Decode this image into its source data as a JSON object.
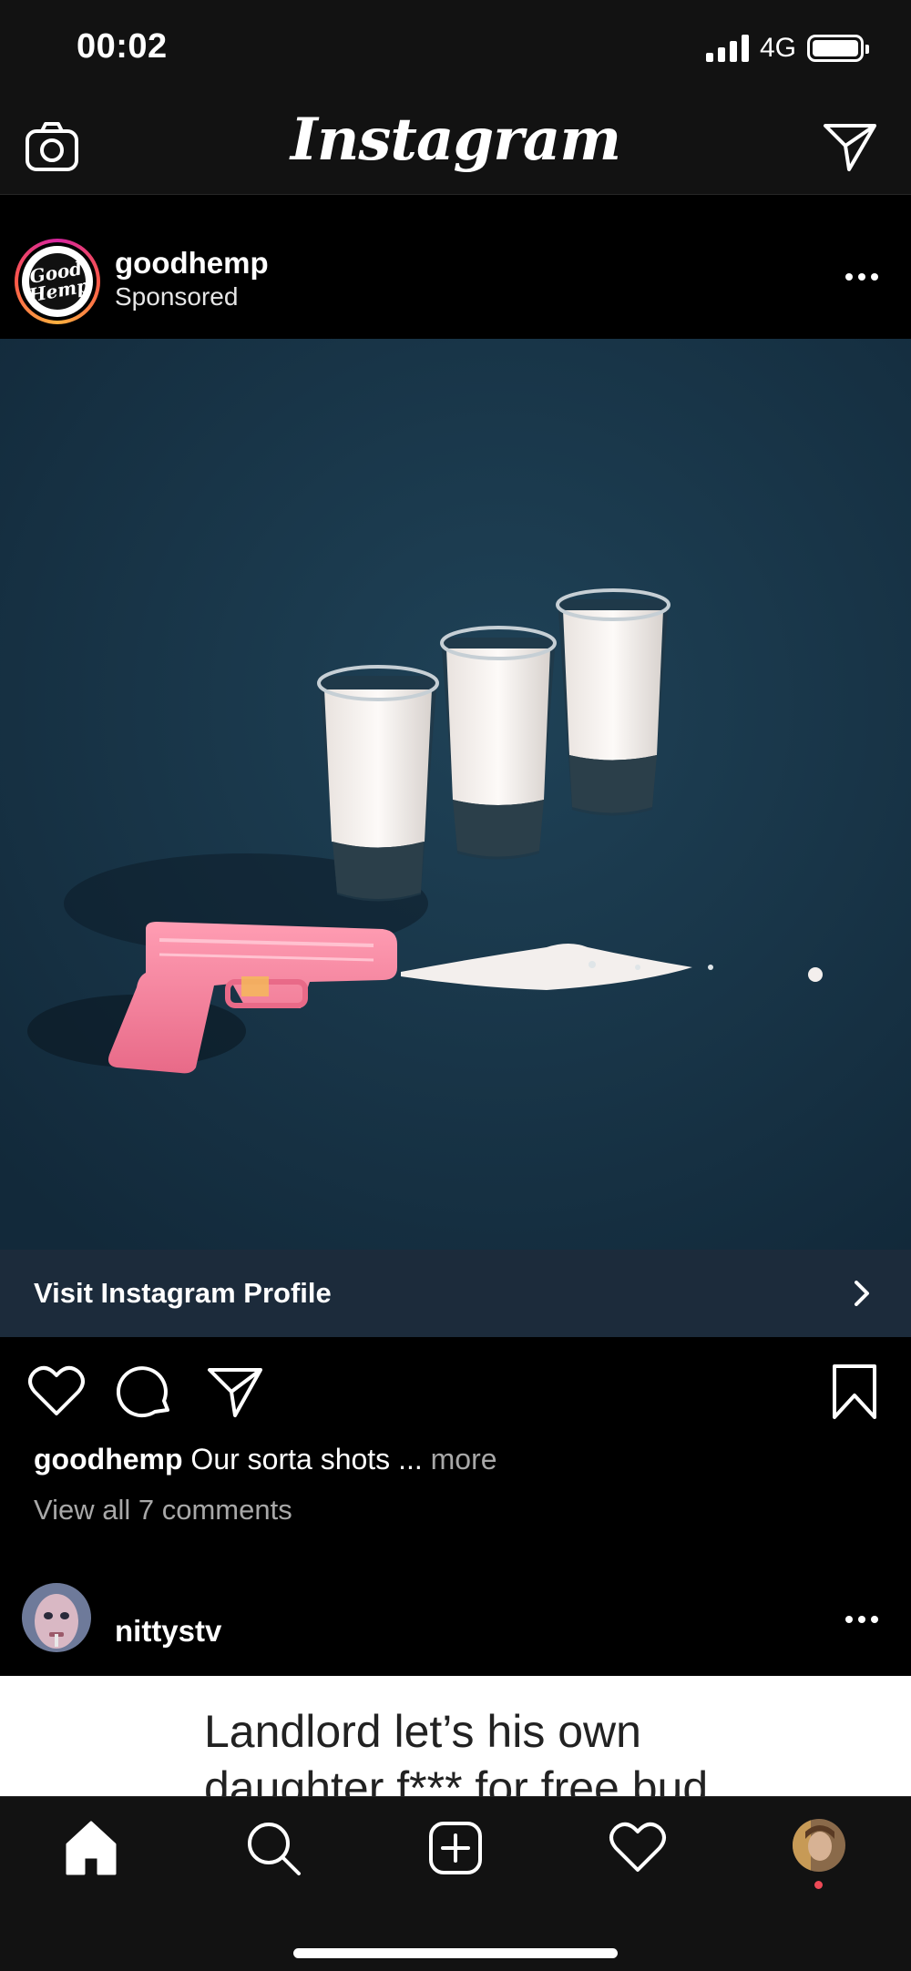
{
  "status_bar": {
    "time": "00:02",
    "network": "4G"
  },
  "header": {
    "logo": "Instagram",
    "icons": {
      "left": "camera-icon",
      "right": "direct-send-icon"
    }
  },
  "post1": {
    "username": "goodhemp",
    "sponsored_label": "Sponsored",
    "avatar_text": "Good Hemp",
    "cta_label": "Visit Instagram Profile",
    "caption_user": "goodhemp",
    "caption_text": " Our sorta shots ... ",
    "caption_more": "more",
    "comments_link": "View all 7 comments"
  },
  "post2": {
    "username": "nittystv",
    "text_line1": "Landlord let’s his own",
    "text_line2": "daughter f*** for free bud"
  },
  "colors": {
    "background": "#000000",
    "bar": "#121212",
    "cta_bar": "#1c2b3b",
    "muted_text": "#a8a8a8",
    "notification": "#ed4956"
  },
  "bottom_nav": {
    "items": [
      "home-icon",
      "search-icon",
      "new-post-icon",
      "activity-heart-icon",
      "profile-avatar"
    ]
  }
}
